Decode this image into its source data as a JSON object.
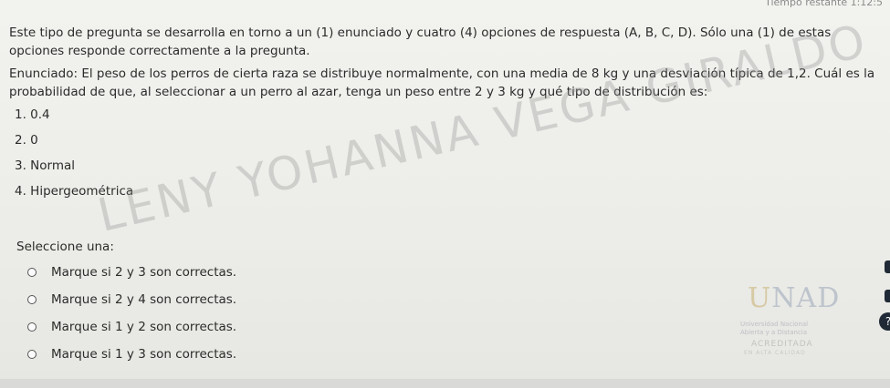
{
  "timer": "Tiempo restante 1:12:5",
  "intro_text": "Este tipo de pregunta se desarrolla en torno a un (1) enunciado y cuatro (4) opciones de respuesta (A, B, C, D). Sólo una (1) de estas opciones responde correctamente a la pregunta.",
  "statement": "Enunciado: El peso de los perros de cierta raza se distribuye normalmente, con una media de 8 kg y una desviación típica de 1,2. Cuál es la probabilidad de que, al seleccionar a un perro al azar, tenga un peso entre 2 y 3 kg y qué tipo de distribución es:",
  "options": [
    "1. 0.4",
    "2. 0",
    "3. Normal",
    "4. Hipergeométrica"
  ],
  "select_label": "Seleccione una:",
  "choices": [
    "Marque si 2 y 3 son correctas.",
    "Marque si 2 y 4 son correctas.",
    "Marque si 1 y 2 son correctas.",
    "Marque si 1 y 3 son correctas."
  ],
  "watermark": "LENY YOHANNA VEGA GIRALDO",
  "logo": {
    "mark_u": "U",
    "mark_nad": "NAD",
    "subtitle": "Universidad Nacional Abierta y a Distancia",
    "acreditada": "ACREDITADA",
    "alta_calidad": "EN ALTA CALIDAD"
  },
  "help_icon": "?"
}
